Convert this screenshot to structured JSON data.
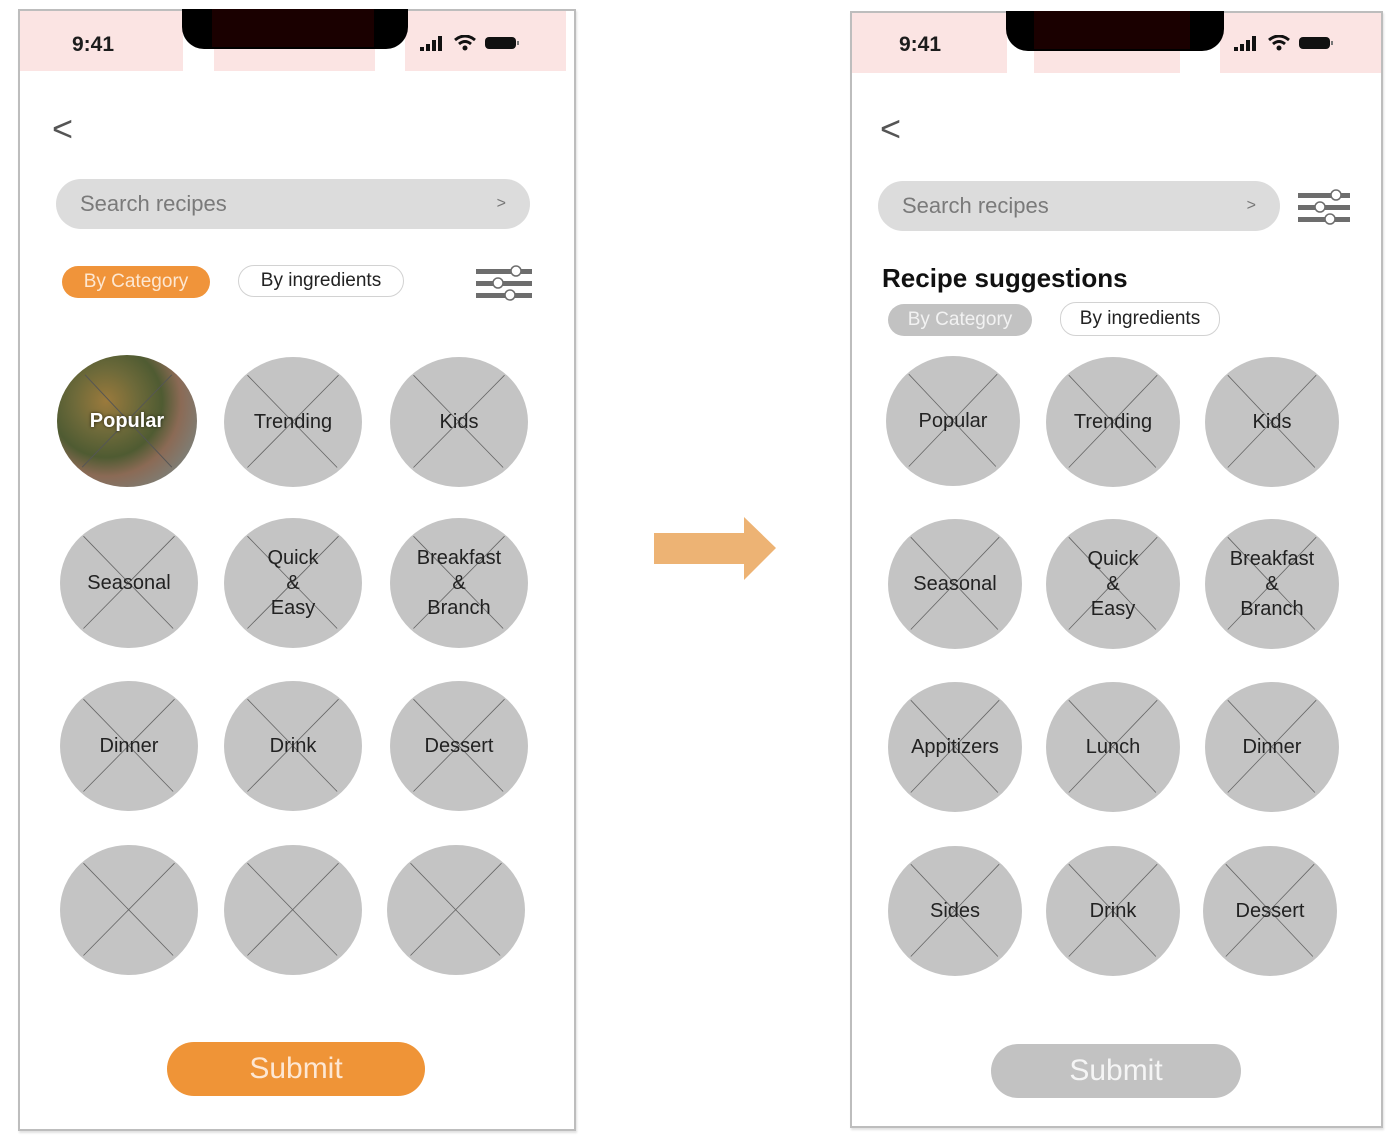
{
  "colors": {
    "accent_orange": "#EF9437",
    "arrow": "#EDB374",
    "status_bar_bg": "#FBE4E3",
    "placeholder_grey": "#C4C4C4",
    "search_bg": "#DCDCDC",
    "disabled_grey": "#C2C2C2"
  },
  "arrow_icon": "right-arrow-icon",
  "before": {
    "status": {
      "time": "9:41",
      "icons": [
        "signal-icon",
        "wifi-icon",
        "battery-icon"
      ]
    },
    "back_label": "<",
    "search": {
      "placeholder": "Search recipes",
      "submit_glyph": ">"
    },
    "filter_icon": "sliders-icon",
    "chips": [
      {
        "label": "By Category",
        "state": "selected"
      },
      {
        "label": "By ingredients",
        "state": "unselected"
      }
    ],
    "categories": [
      {
        "label": "Popular",
        "image": "food-photo"
      },
      {
        "label": "Trending"
      },
      {
        "label": "Kids"
      },
      {
        "label": "Seasonal"
      },
      {
        "label": "Quick\n&\nEasy"
      },
      {
        "label": "Breakfast\n&\nBranch"
      },
      {
        "label": "Dinner"
      },
      {
        "label": "Drink"
      },
      {
        "label": "Dessert"
      },
      {
        "label": ""
      },
      {
        "label": ""
      },
      {
        "label": ""
      }
    ],
    "submit_label": "Submit"
  },
  "after": {
    "status": {
      "time": "9:41",
      "icons": [
        "signal-icon",
        "wifi-icon",
        "battery-icon"
      ]
    },
    "back_label": "<",
    "search": {
      "placeholder": "Search recipes",
      "submit_glyph": ">"
    },
    "filter_icon": "sliders-icon",
    "section_title": "Recipe suggestions",
    "chips": [
      {
        "label": "By Category",
        "state": "selected"
      },
      {
        "label": "By ingredients",
        "state": "unselected"
      }
    ],
    "categories": [
      {
        "label": "Popular"
      },
      {
        "label": "Trending"
      },
      {
        "label": "Kids"
      },
      {
        "label": "Seasonal"
      },
      {
        "label": "Quick\n&\nEasy"
      },
      {
        "label": "Breakfast\n&\nBranch"
      },
      {
        "label": "Appitizers"
      },
      {
        "label": "Lunch"
      },
      {
        "label": "Dinner"
      },
      {
        "label": "Sides"
      },
      {
        "label": "Drink"
      },
      {
        "label": "Dessert"
      }
    ],
    "submit_label": "Submit",
    "submit_state": "disabled"
  }
}
